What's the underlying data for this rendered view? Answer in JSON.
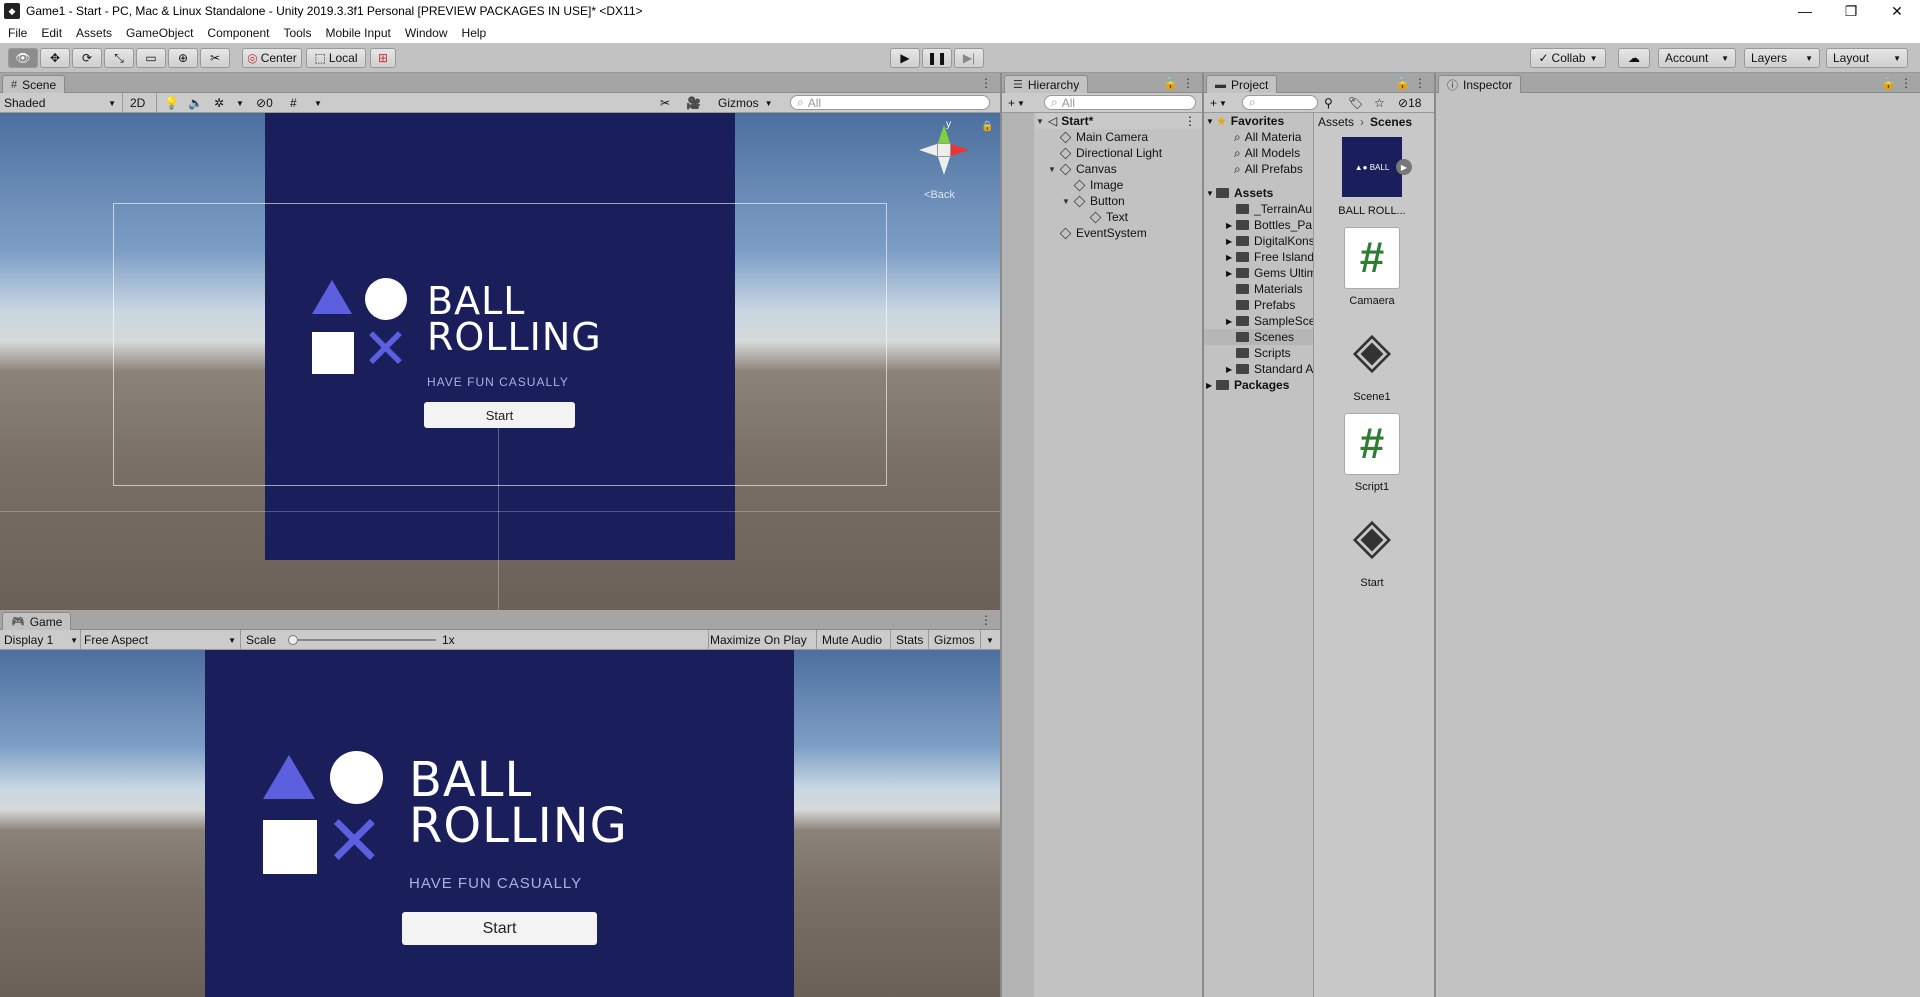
{
  "titlebar": {
    "title": "Game1 - Start - PC, Mac & Linux Standalone - Unity 2019.3.3f1 Personal [PREVIEW PACKAGES IN USE]* <DX11>",
    "minimize": "—",
    "restore": "❐",
    "close": "✕"
  },
  "menu": [
    "File",
    "Edit",
    "Assets",
    "GameObject",
    "Component",
    "Tools",
    "Mobile Input",
    "Window",
    "Help"
  ],
  "toolbar": {
    "pivot": "Center",
    "space": "Local",
    "collab": "Collab",
    "account": "Account",
    "layers": "Layers",
    "layout": "Layout"
  },
  "scene": {
    "tab": "Scene",
    "shading": "Shaded",
    "mode2d": "2D",
    "hidden_count": "0",
    "gizmos": "Gizmos",
    "search_placeholder": "All",
    "gizmo_y": "y",
    "gizmo_back": "Back"
  },
  "game": {
    "tab": "Game",
    "display": "Display 1",
    "aspect": "Free Aspect",
    "scale_label": "Scale",
    "scale_value": "1x",
    "scale_level": 0.0,
    "maximize": "Maximize On Play",
    "mute": "Mute Audio",
    "stats": "Stats",
    "gizmos": "Gizmos"
  },
  "ui_content": {
    "title_line1": "BALL",
    "title_line2": "ROLLING",
    "subtitle": "HAVE FUN CASUALLY",
    "button": "Start"
  },
  "hierarchy": {
    "tab": "Hierarchy",
    "search_placeholder": "All",
    "items": [
      {
        "label": "Start*",
        "depth": 0,
        "expanded": true,
        "bold": true
      },
      {
        "label": "Main Camera",
        "depth": 1
      },
      {
        "label": "Directional Light",
        "depth": 1
      },
      {
        "label": "Canvas",
        "depth": 1,
        "expanded": true
      },
      {
        "label": "Image",
        "depth": 2
      },
      {
        "label": "Button",
        "depth": 2,
        "expanded": true
      },
      {
        "label": "Text",
        "depth": 3
      },
      {
        "label": "EventSystem",
        "depth": 1
      }
    ]
  },
  "project": {
    "tab": "Project",
    "hidden_count": "18",
    "breadcrumb": [
      "Assets",
      "Scenes"
    ],
    "favorites_label": "Favorites",
    "favorites": [
      "All Materia",
      "All Models",
      "All Prefabs"
    ],
    "assets_label": "Assets",
    "folders": [
      "_TerrainAu",
      "Bottles_Pa",
      "DigitalKons",
      "Free Island",
      "Gems Ultim",
      "Materials",
      "Prefabs",
      "SampleSce",
      "Scenes",
      "Scripts",
      "Standard A"
    ],
    "packages_label": "Packages",
    "selected_folder": "Scenes",
    "assets": [
      {
        "label": "BALL ROLL...",
        "type": "image"
      },
      {
        "label": "Camaera",
        "type": "script"
      },
      {
        "label": "Scene1",
        "type": "scene"
      },
      {
        "label": "Script1",
        "type": "script"
      },
      {
        "label": "Start",
        "type": "scene"
      }
    ]
  },
  "inspector": {
    "tab": "Inspector"
  },
  "colors": {
    "canvas_bg": "#1a1f5c",
    "accent_shape": "#5b5fe0",
    "panel_bg": "#c2c2c2"
  }
}
